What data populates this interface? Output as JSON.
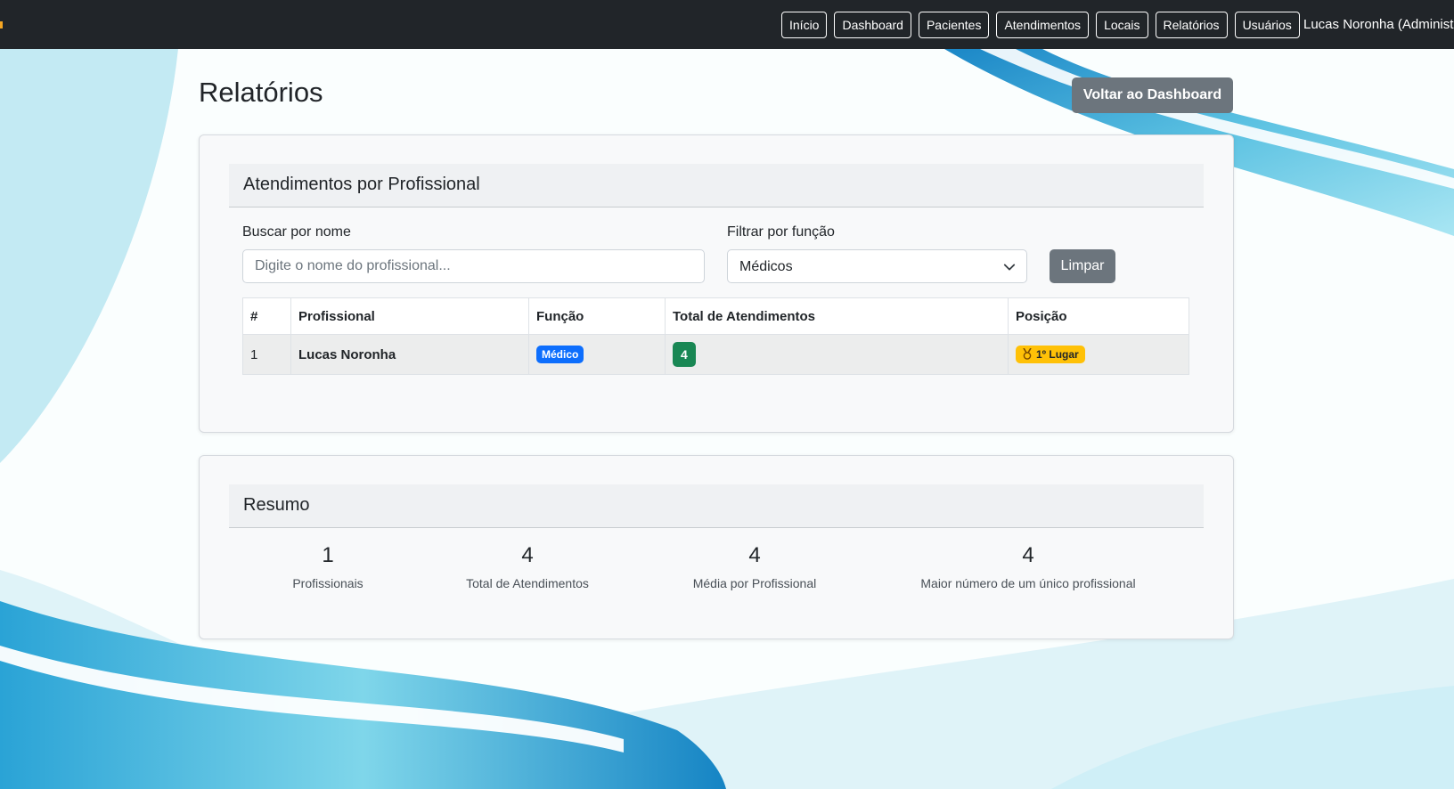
{
  "navbar": {
    "links": [
      "Início",
      "Dashboard",
      "Pacientes",
      "Atendimentos",
      "Locais",
      "Relatórios",
      "Usuários"
    ],
    "user_label": "Lucas Noronha (Administ"
  },
  "page": {
    "title": "Relatórios",
    "back_button": "Voltar ao Dashboard"
  },
  "ranking_card": {
    "title": "Atendimentos por Profissional",
    "search_label": "Buscar por nome",
    "search_placeholder": "Digite o nome do profissional...",
    "search_value": "",
    "filter_label": "Filtrar por função",
    "filter_value": "Médicos",
    "clear_button": "Limpar",
    "columns": [
      "#",
      "Profissional",
      "Função",
      "Total de Atendimentos",
      "Posição"
    ],
    "rows": [
      {
        "rank": "1",
        "name": "Lucas Noronha",
        "role": "Médico",
        "total": "4",
        "position": "1º Lugar",
        "position_icon": "medal-icon"
      }
    ]
  },
  "summary_card": {
    "title": "Resumo",
    "stats": [
      {
        "value": "1",
        "label": "Profissionais"
      },
      {
        "value": "4",
        "label": "Total de Atendimentos"
      },
      {
        "value": "4",
        "label": "Média por Profissional"
      },
      {
        "value": "4",
        "label": "Maior número de um único profissional"
      }
    ]
  },
  "colors": {
    "navbar": "#212529",
    "secondary_button": "#6c757d",
    "role_badge": "#0d6efd",
    "total_badge": "#198754",
    "position_badge": "#ffc107",
    "background_wave": "#1b8fc9"
  }
}
